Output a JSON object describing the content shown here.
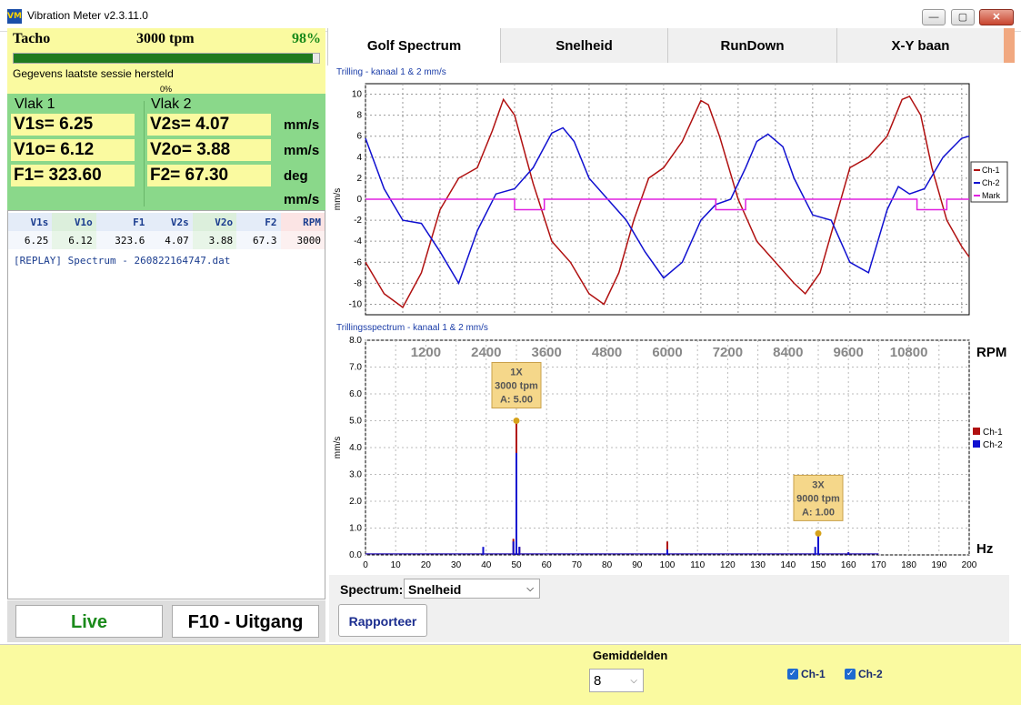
{
  "window": {
    "title": "Vibration Meter v2.3.11.0",
    "icon_text": "VM",
    "min_glyph": "—",
    "max_glyph": "▢",
    "close_glyph": "✕"
  },
  "tacho": {
    "label": "Tacho",
    "rpm": "3000 tpm",
    "percent_text": "98%",
    "progress": 0.98,
    "status_message": "Gegevens laatste sessie hersteld",
    "status_percent": "0%"
  },
  "vlak1": {
    "title": "Vlak 1",
    "v1s": "V1s= 6.25",
    "v1o": "V1o= 6.12",
    "f1": "F1= 323.60"
  },
  "vlak2": {
    "title": "Vlak 2",
    "v2s": "V2s= 4.07",
    "v2o": "V2o= 3.88",
    "f2": "F2= 67.30"
  },
  "units": [
    "mm/s",
    "mm/s",
    "deg",
    "mm/s"
  ],
  "table": {
    "headers": [
      "V1s",
      "V1o",
      "F1",
      "V2s",
      "V2o",
      "F2",
      "RPM"
    ],
    "row": [
      "6.25",
      "6.12",
      "323.6",
      "4.07",
      "3.88",
      "67.3",
      "3000"
    ],
    "log": "[REPLAY] Spectrum - 260822164747.dat"
  },
  "buttons": {
    "live": "Live",
    "exit": "F10 - Uitgang",
    "report": "Rapporteer"
  },
  "tabs": [
    "Golf Spectrum",
    "Snelheid",
    "RunDown",
    "X-Y baan"
  ],
  "spectrum_control": {
    "label": "Spectrum:",
    "value": "Snelheid"
  },
  "averaging": {
    "label": "Gemiddelden",
    "value": "8"
  },
  "checkboxes": {
    "ch1": "Ch-1",
    "ch2": "Ch-2",
    "check_glyph": "✓"
  },
  "colors": {
    "ch1": "#b01010",
    "ch2": "#1010d0",
    "mark": "#e020e0",
    "accent_green": "#8ad88a",
    "accent_yellow": "#fafaa0"
  },
  "chart_data": [
    {
      "type": "line",
      "title": "Trilling  - kanaal 1 & 2 mm/s",
      "ylabel": "mm/s",
      "xlim": [
        0,
        810
      ],
      "ylim": [
        -11,
        11
      ],
      "xticks": [
        "0",
        "50",
        "100",
        "150",
        "200",
        "250",
        "300",
        "350",
        "400",
        "450",
        "500",
        "550",
        "600",
        "650",
        "700",
        "750",
        "800"
      ],
      "yticks": [
        "10",
        "8",
        "6",
        "4",
        "2",
        "0",
        "-2",
        "-4",
        "-6",
        "-8",
        "-10"
      ],
      "legend": "right",
      "grid": true,
      "series": [
        {
          "name": "Ch-1",
          "x": [
            0,
            25,
            50,
            75,
            100,
            125,
            150,
            170,
            185,
            200,
            225,
            250,
            275,
            300,
            320,
            340,
            360,
            380,
            400,
            425,
            450,
            460,
            475,
            500,
            525,
            550,
            575,
            590,
            610,
            630,
            650,
            675,
            700,
            720,
            730,
            745,
            760,
            780,
            800,
            810
          ],
          "y": [
            -6,
            -9,
            -10.3,
            -7,
            -1,
            2,
            3,
            6.5,
            9.5,
            8,
            1.5,
            -4,
            -6,
            -9,
            -10,
            -7,
            -2,
            2,
            3,
            5.5,
            9.4,
            9,
            6,
            0,
            -4,
            -6,
            -8,
            -9,
            -7,
            -2,
            3,
            4,
            6,
            9.5,
            9.8,
            8,
            3,
            -2,
            -4.5,
            -5.5
          ]
        },
        {
          "name": "Ch-2",
          "x": [
            0,
            25,
            50,
            75,
            100,
            125,
            150,
            175,
            200,
            225,
            250,
            265,
            280,
            300,
            325,
            350,
            375,
            400,
            425,
            450,
            470,
            490,
            510,
            525,
            540,
            560,
            575,
            600,
            625,
            650,
            675,
            700,
            715,
            730,
            750,
            775,
            800,
            810
          ],
          "y": [
            5.8,
            1,
            -2,
            -2.3,
            -5,
            -8,
            -3,
            0.5,
            1,
            3,
            6.3,
            6.8,
            5.5,
            2,
            0,
            -2,
            -5,
            -7.5,
            -6,
            -2,
            -0.5,
            0,
            3,
            5.5,
            6.2,
            5,
            2,
            -1.5,
            -2,
            -6,
            -7,
            -1,
            1.2,
            0.5,
            1,
            4,
            5.8,
            6
          ]
        },
        {
          "name": "Mark",
          "x": [
            0,
            200,
            200,
            240,
            240,
            470,
            470,
            510,
            510,
            740,
            740,
            780,
            780,
            810
          ],
          "y": [
            0,
            0,
            -1,
            -1,
            0,
            0,
            -1,
            -1,
            0,
            0,
            -1,
            -1,
            0,
            0
          ]
        }
      ]
    },
    {
      "type": "bar",
      "title": "Trillingsspectrum  - kanaal 1 & 2 mm/s",
      "ylabel": "mm/s",
      "xlim": [
        0,
        200
      ],
      "ylim": [
        0,
        8
      ],
      "xticks": [
        "0",
        "10",
        "20",
        "30",
        "40",
        "50",
        "60",
        "70",
        "80",
        "90",
        "100",
        "110",
        "120",
        "130",
        "140",
        "150",
        "160",
        "170",
        "180",
        "190",
        "200"
      ],
      "yticks": [
        "8.0",
        "7.0",
        "6.0",
        "5.0",
        "4.0",
        "3.0",
        "2.0",
        "1.0",
        "0.0"
      ],
      "rpm_ticks": [
        "1200",
        "2400",
        "3600",
        "4800",
        "6000",
        "7200",
        "8400",
        "9600",
        "10800"
      ],
      "rpm_label": "RPM",
      "hz_label": "Hz",
      "legend": "right",
      "grid": true,
      "series": [
        {
          "name": "Ch-1",
          "x": [
            39,
            49,
            50,
            51,
            100,
            150,
            160
          ],
          "y": [
            0.2,
            0.6,
            5.0,
            0.3,
            0.5,
            0.3,
            0.1
          ]
        },
        {
          "name": "Ch-2",
          "x": [
            39,
            49,
            50,
            51,
            100,
            149,
            150,
            160
          ],
          "y": [
            0.3,
            0.5,
            3.8,
            0.3,
            0.2,
            0.3,
            0.8,
            0.1
          ]
        }
      ],
      "annotations": [
        {
          "x": 50,
          "y": 5.0,
          "line1": "1X",
          "line2": "3000 tpm",
          "line3": "A: 5.00"
        },
        {
          "x": 150,
          "y": 0.8,
          "line1": "3X",
          "line2": "9000 tpm",
          "line3": "A: 1.00"
        }
      ]
    }
  ]
}
